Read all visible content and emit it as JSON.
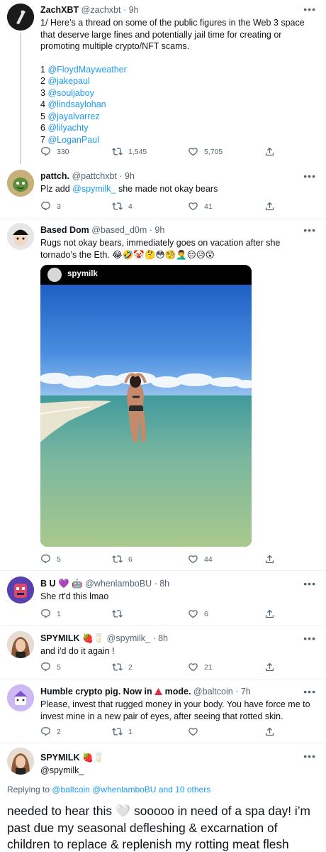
{
  "tweets": [
    {
      "name": "ZachXBT",
      "handle": "@zachxbt",
      "time": "· 9h",
      "text_intro": "1/ Here’s a thread on some of the public figures in the Web 3 space that deserve large fines and potentially jail time for creating or promoting multiple crypto/NFT scams.",
      "list": [
        {
          "num": "1",
          "user": "@FloydMayweather"
        },
        {
          "num": "2",
          "user": "@jakepaul"
        },
        {
          "num": "3",
          "user": "@souljaboy"
        },
        {
          "num": "4",
          "user": "@lindsaylohan"
        },
        {
          "num": "5",
          "user": "@jayalvarrez"
        },
        {
          "num": "6",
          "user": "@lilyachty"
        },
        {
          "num": "7",
          "user": "@LoganPaul"
        }
      ],
      "replies": "330",
      "retweets": "1,545",
      "likes": "5,705"
    },
    {
      "name": "pattch.",
      "handle": "@pattchxbt",
      "time": "· 9h",
      "text_pre": "Plz add ",
      "mention": "@spymilk_",
      "text_post": " she made not okay bears",
      "replies": "3",
      "retweets": "4",
      "likes": "41"
    },
    {
      "name": "Based Dom",
      "handle": "@based_d0m",
      "time": "· 9h",
      "text": "Rugs not okay bears, immediately goes on vacation after she tornado’s the Eth.",
      "emojis": "😂🤣🤡🤔😳🧐🤦‍♂️😔😥😲",
      "media_name": "spymilk",
      "replies": "5",
      "retweets": "6",
      "likes": "44"
    },
    {
      "name": "B U",
      "name_emojis": "💜 🤖",
      "handle": "@whenlamboBU",
      "time": "· 8h",
      "text": "She rt'd this lmao",
      "replies": "1",
      "retweets": "",
      "likes": "6"
    },
    {
      "name": "SPYMILK",
      "name_emojis": "🍓🥛",
      "handle": "@spymilk_",
      "time": "· 8h",
      "text": "and i'd do it again !",
      "replies": "5",
      "retweets": "2",
      "likes": "21"
    },
    {
      "name": "Humble crypto pig. Now in",
      "name_mode": "mode.",
      "handle": "@baltcoin",
      "time": "· 7h",
      "text": "Please, invest that rugged money in your body. You have force me to invest mine in a new pair of eyes, after seeing that rotted skin.",
      "replies": "2",
      "retweets": "1",
      "likes": ""
    }
  ],
  "main": {
    "name": "SPYMILK",
    "name_emojis": "🍓🥛",
    "handle": "@spymilk_",
    "replying_prefix": "Replying to ",
    "replying_users": "@baltcoin @whenlamboBU",
    "replying_suffix": " and 10 others",
    "text_a": "needed to hear this",
    "heart": "🤍",
    "text_b": "sooooo in need of a spa day! i’m past due my seasonal defleshing & excarnation of children to replace & replenish my rotting meat flesh"
  },
  "colors": {
    "link": "#1d9bf0",
    "secondary": "#536471",
    "text": "#0f1419"
  },
  "icons": [
    "reply-icon",
    "retweet-icon",
    "like-icon",
    "share-icon",
    "more-icon"
  ]
}
